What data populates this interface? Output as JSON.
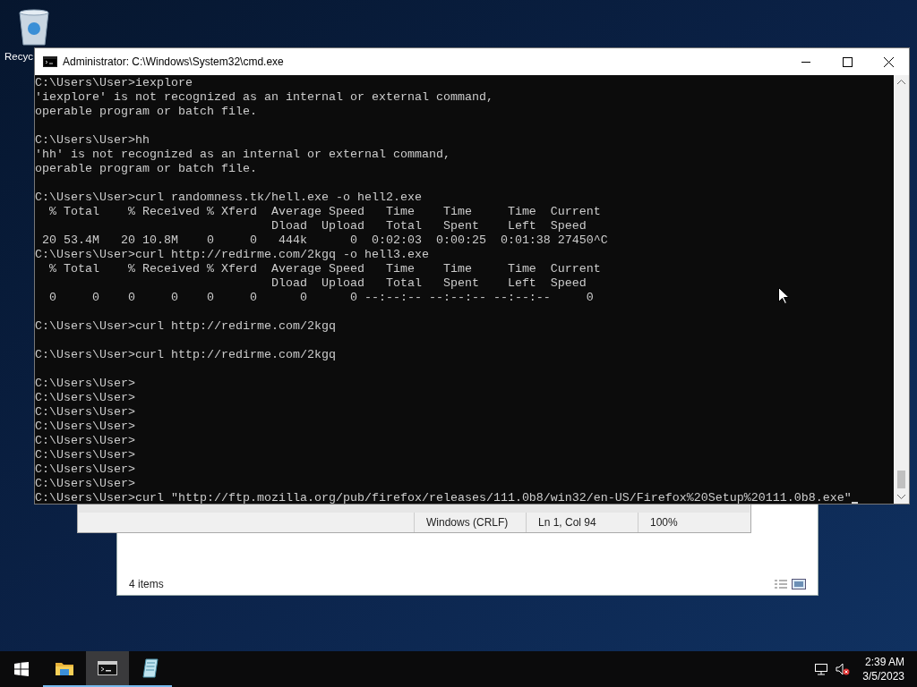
{
  "desktop_icons": [
    {
      "label": "Recyc"
    }
  ],
  "notepad_window": {
    "status_bar": [
      "Windows (CRLF)",
      "Ln 1, Col 94",
      "100%"
    ]
  },
  "explorer_window": {
    "status": "4 items"
  },
  "console_window": {
    "title": "Administrator: C:\\Windows\\System32\\cmd.exe",
    "blocks": [
      {
        "lines": [
          "C:\\Users\\User>iexplore",
          "'iexplore' is not recognized as an internal or external command,",
          "operable program or batch file."
        ]
      },
      {
        "lines": [
          "C:\\Users\\User>hh",
          "'hh' is not recognized as an internal or external command,",
          "operable program or batch file."
        ]
      },
      {
        "lines": [
          "C:\\Users\\User>curl randomness.tk/hell.exe -o hell2.exe",
          "  % Total    % Received % Xferd  Average Speed   Time    Time     Time  Current",
          "                                 Dload  Upload   Total   Spent    Left  Speed",
          " 20 53.4M   20 10.8M    0     0   444k      0  0:02:03  0:00:25  0:01:38 27450^C",
          "C:\\Users\\User>curl http://redirme.com/2kgq -o hell3.exe",
          "  % Total    % Received % Xferd  Average Speed   Time    Time     Time  Current",
          "                                 Dload  Upload   Total   Spent    Left  Speed",
          "  0     0    0     0    0     0      0      0 --:--:-- --:--:-- --:--:--     0"
        ]
      },
      {
        "lines": [
          "C:\\Users\\User>curl http://redirme.com/2kgq"
        ]
      },
      {
        "lines": [
          "C:\\Users\\User>curl http://redirme.com/2kgq"
        ]
      },
      {
        "lines": [
          "C:\\Users\\User>",
          "C:\\Users\\User>",
          "C:\\Users\\User>",
          "C:\\Users\\User>",
          "C:\\Users\\User>",
          "C:\\Users\\User>",
          "C:\\Users\\User>",
          "C:\\Users\\User>",
          "C:\\Users\\User>curl \"http://ftp.mozilla.org/pub/firefox/releases/111.0b8/win32/en-US/Firefox%20Setup%20111.0b8.exe\""
        ]
      }
    ]
  },
  "taskbar": {
    "apps": [
      {
        "kind": "folder",
        "selected": false
      },
      {
        "kind": "console",
        "selected": true
      },
      {
        "kind": "notepad",
        "selected": false
      }
    ],
    "clock": {
      "time": "2:39 AM",
      "date": "3/5/2023"
    }
  }
}
